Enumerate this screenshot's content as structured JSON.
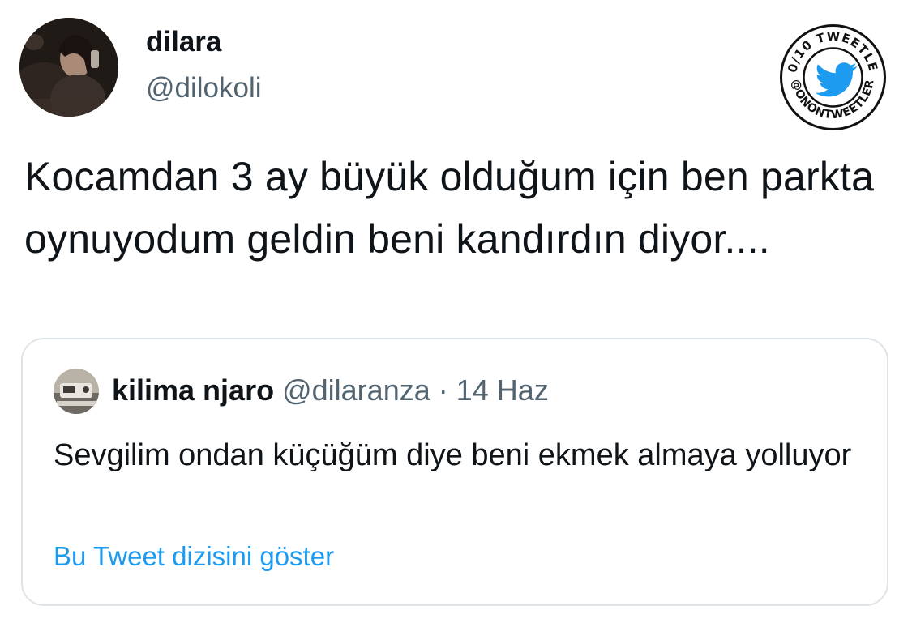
{
  "tweet": {
    "author": {
      "display_name": "dilara",
      "handle": "@dilokoli",
      "avatar_icon": "profile-photo"
    },
    "text": "Kocamdan 3 ay büyük olduğum için ben parkta oynuyodum geldin beni kandırdın diyor...."
  },
  "quoted_tweet": {
    "author": {
      "display_name": "kilima njaro",
      "handle": "@dilaranza",
      "avatar_icon": "profile-photo"
    },
    "separator": "·",
    "date": "14 Haz",
    "text": "Sevgilim ondan küçüğüm diye beni ekmek almaya yolluyor",
    "show_thread_label": "Bu Tweet dizisini göster"
  },
  "watermark": {
    "top_text": "10/10 TWEETLER",
    "bottom_text": "@ONONTWEETLER",
    "icon": "twitter-bird-icon"
  },
  "colors": {
    "text_primary": "#0f1419",
    "text_secondary": "#536471",
    "link": "#1d9bf0",
    "border": "#dfe4e8",
    "twitter_blue": "#1d9bf0"
  }
}
